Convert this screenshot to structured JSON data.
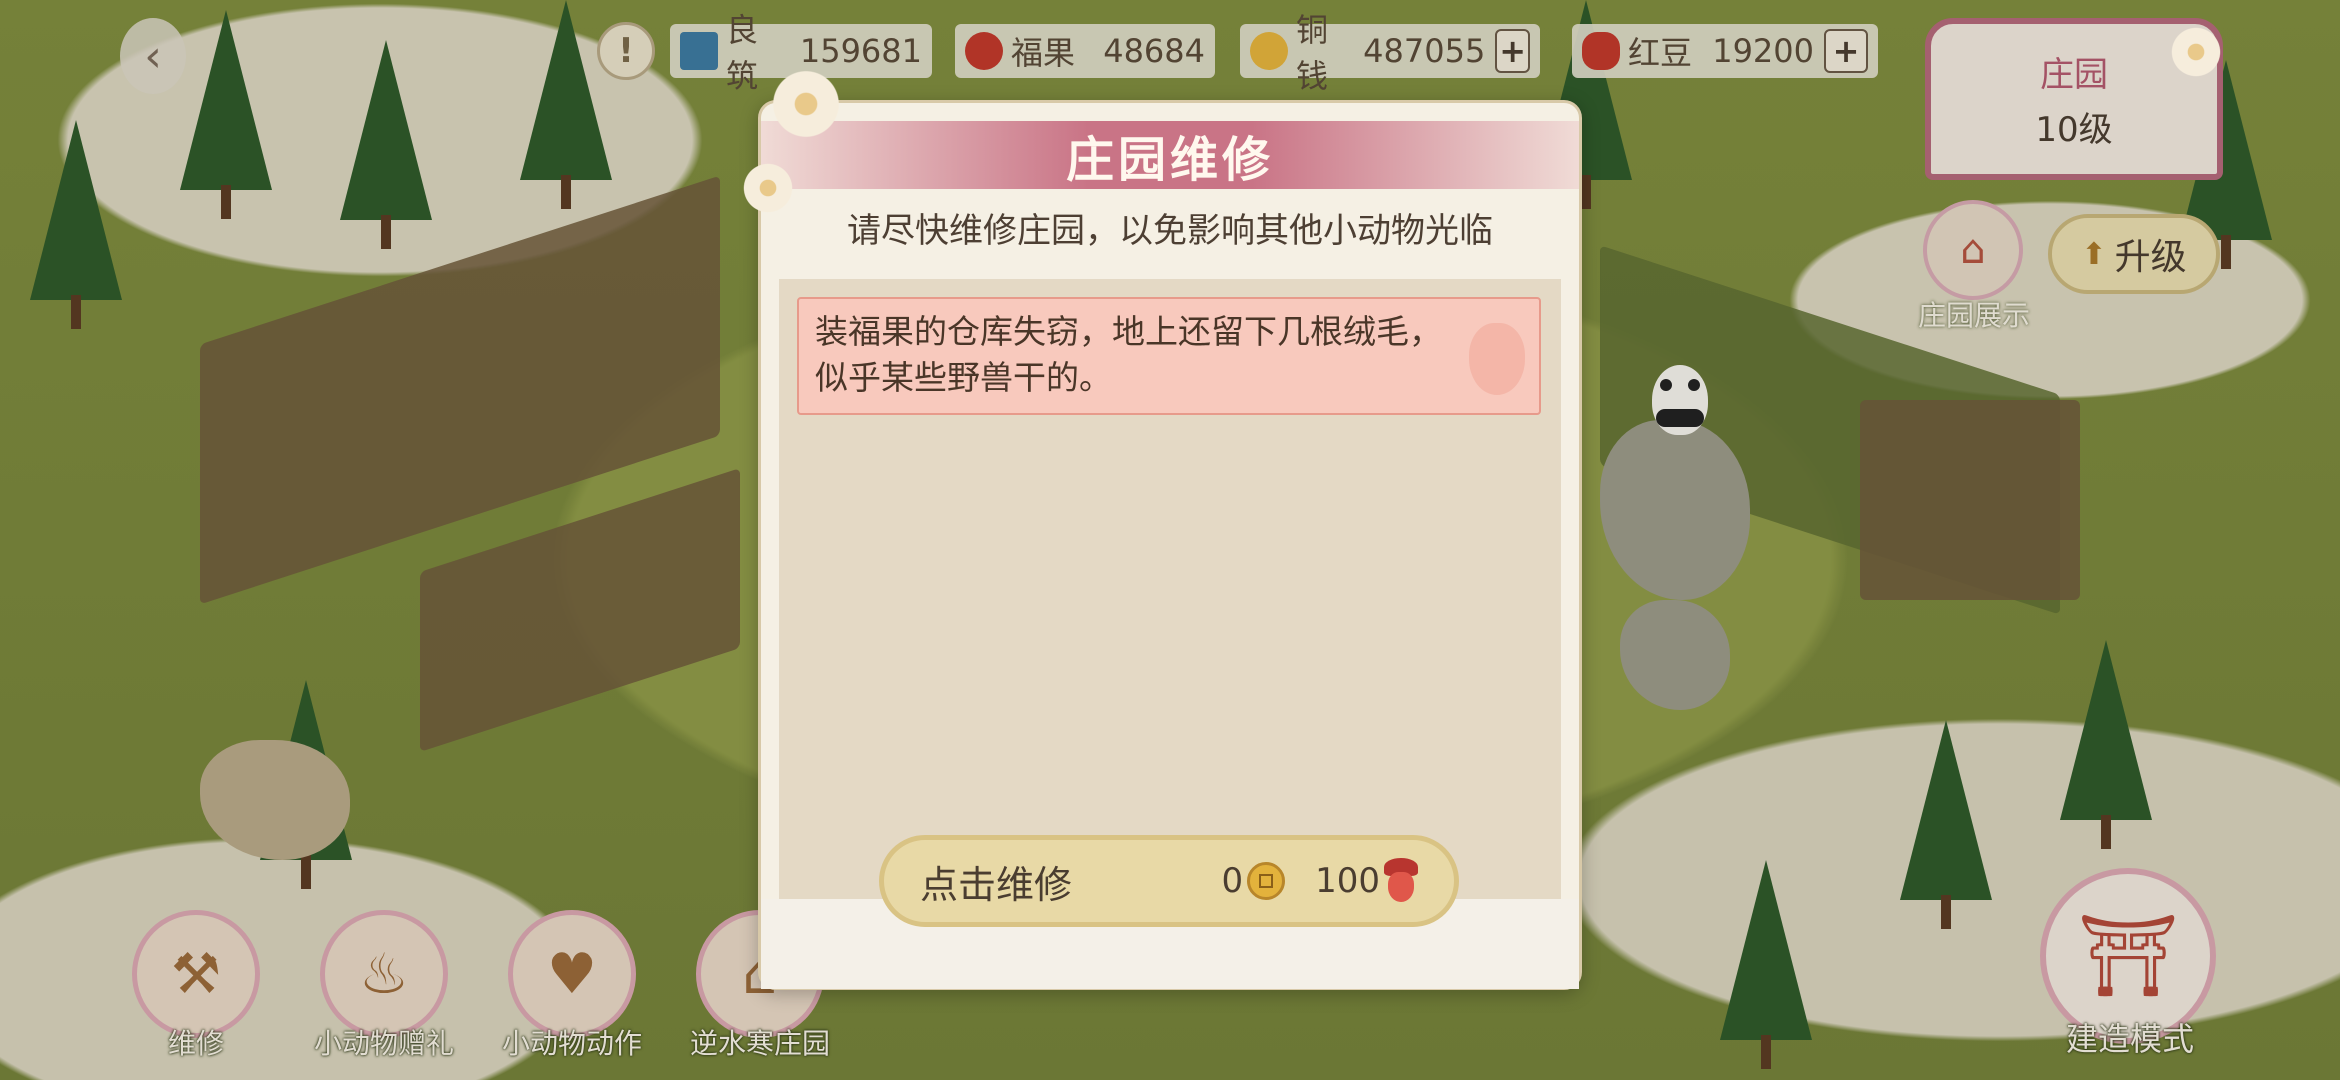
{
  "header": {
    "resources": [
      {
        "label": "良筑",
        "value": "159681",
        "icon": "house-icon",
        "color": "#3d7aa0",
        "has_plus": false
      },
      {
        "label": "福果",
        "value": "48684",
        "icon": "acorn-icon",
        "color": "#c0392b",
        "has_plus": false
      },
      {
        "label": "铜钱",
        "value": "487055",
        "icon": "coin-icon",
        "color": "#e3b23c",
        "has_plus": true
      },
      {
        "label": "红豆",
        "value": "19200",
        "icon": "red-bean-icon",
        "color": "#c0392b",
        "has_plus": true
      }
    ],
    "plus_symbol": "+",
    "back_symbol": "‹",
    "alert_symbol": "!"
  },
  "manor": {
    "title": "庄园",
    "level": "10级"
  },
  "upgrade": {
    "label": "升级",
    "arrow": "⬆"
  },
  "showcase": {
    "label": "庄园展示"
  },
  "dialog": {
    "title": "庄园维修",
    "subtitle": "请尽快维修庄园，以免影响其他小动物光临",
    "event_text_line1": "装福果的仓库失窃，地上还留下几根绒毛，",
    "event_text_line2": "似乎某些野兽干的。",
    "repair_button": {
      "label": "点击维修",
      "coin_cost": "0",
      "acorn_cost": "100"
    }
  },
  "bottom_actions": [
    {
      "label": "维修",
      "icon": "hammer-icon",
      "glyph": "⚒"
    },
    {
      "label": "小动物赠礼",
      "icon": "gift-bag-icon",
      "glyph": "♨"
    },
    {
      "label": "小动物动作",
      "icon": "heart-hand-icon",
      "glyph": "♥"
    },
    {
      "label": "逆水寒庄园",
      "icon": "pavilion-icon",
      "glyph": "⌂"
    }
  ],
  "build_mode": {
    "label": "建造模式",
    "glyph": "⛩"
  },
  "panda_label": "熊猫"
}
